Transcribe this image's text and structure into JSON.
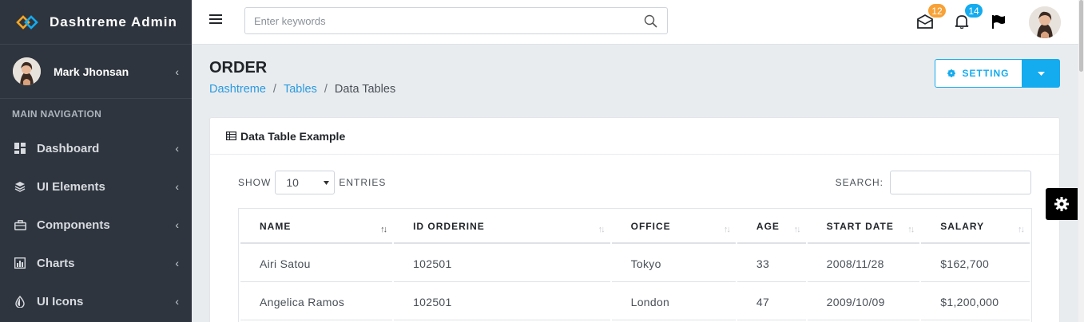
{
  "brand": {
    "name": "Dashtreme Admin"
  },
  "user": {
    "name": "Mark Jhonsan"
  },
  "sidebar": {
    "header": "MAIN NAVIGATION",
    "items": [
      {
        "label": "Dashboard",
        "icon": "dashboard-icon"
      },
      {
        "label": "UI Elements",
        "icon": "layers-icon"
      },
      {
        "label": "Components",
        "icon": "briefcase-icon"
      },
      {
        "label": "Charts",
        "icon": "bar-chart-icon"
      },
      {
        "label": "UI Icons",
        "icon": "tint-icon"
      }
    ]
  },
  "topbar": {
    "search_placeholder": "Enter keywords",
    "mail_count": "12",
    "bell_count": "14"
  },
  "page": {
    "title": "ORDER",
    "breadcrumb": [
      "Dashtreme",
      "Tables",
      "Data Tables"
    ],
    "setting_label": "SETTING"
  },
  "card": {
    "title": "Data Table Example",
    "show_label": "SHOW",
    "entries_value": "10",
    "entries_label": "ENTRIES",
    "search_label": "SEARCH:"
  },
  "table": {
    "headers": [
      "NAME",
      "ID ORDERINE",
      "OFFICE",
      "AGE",
      "START DATE",
      "SALARY"
    ],
    "rows": [
      [
        "Airi Satou",
        "102501",
        "Tokyo",
        "33",
        "2008/11/28",
        "$162,700"
      ],
      [
        "Angelica Ramos",
        "102501",
        "London",
        "47",
        "2009/10/09",
        "$1,200,000"
      ]
    ]
  },
  "colors": {
    "sidebar_bg": "#2f353e",
    "accent": "#14abef",
    "mail_badge": "#f7a136",
    "bell_badge": "#14abef",
    "brand_logo_orange": "#f5a623",
    "brand_logo_blue": "#14abef"
  }
}
